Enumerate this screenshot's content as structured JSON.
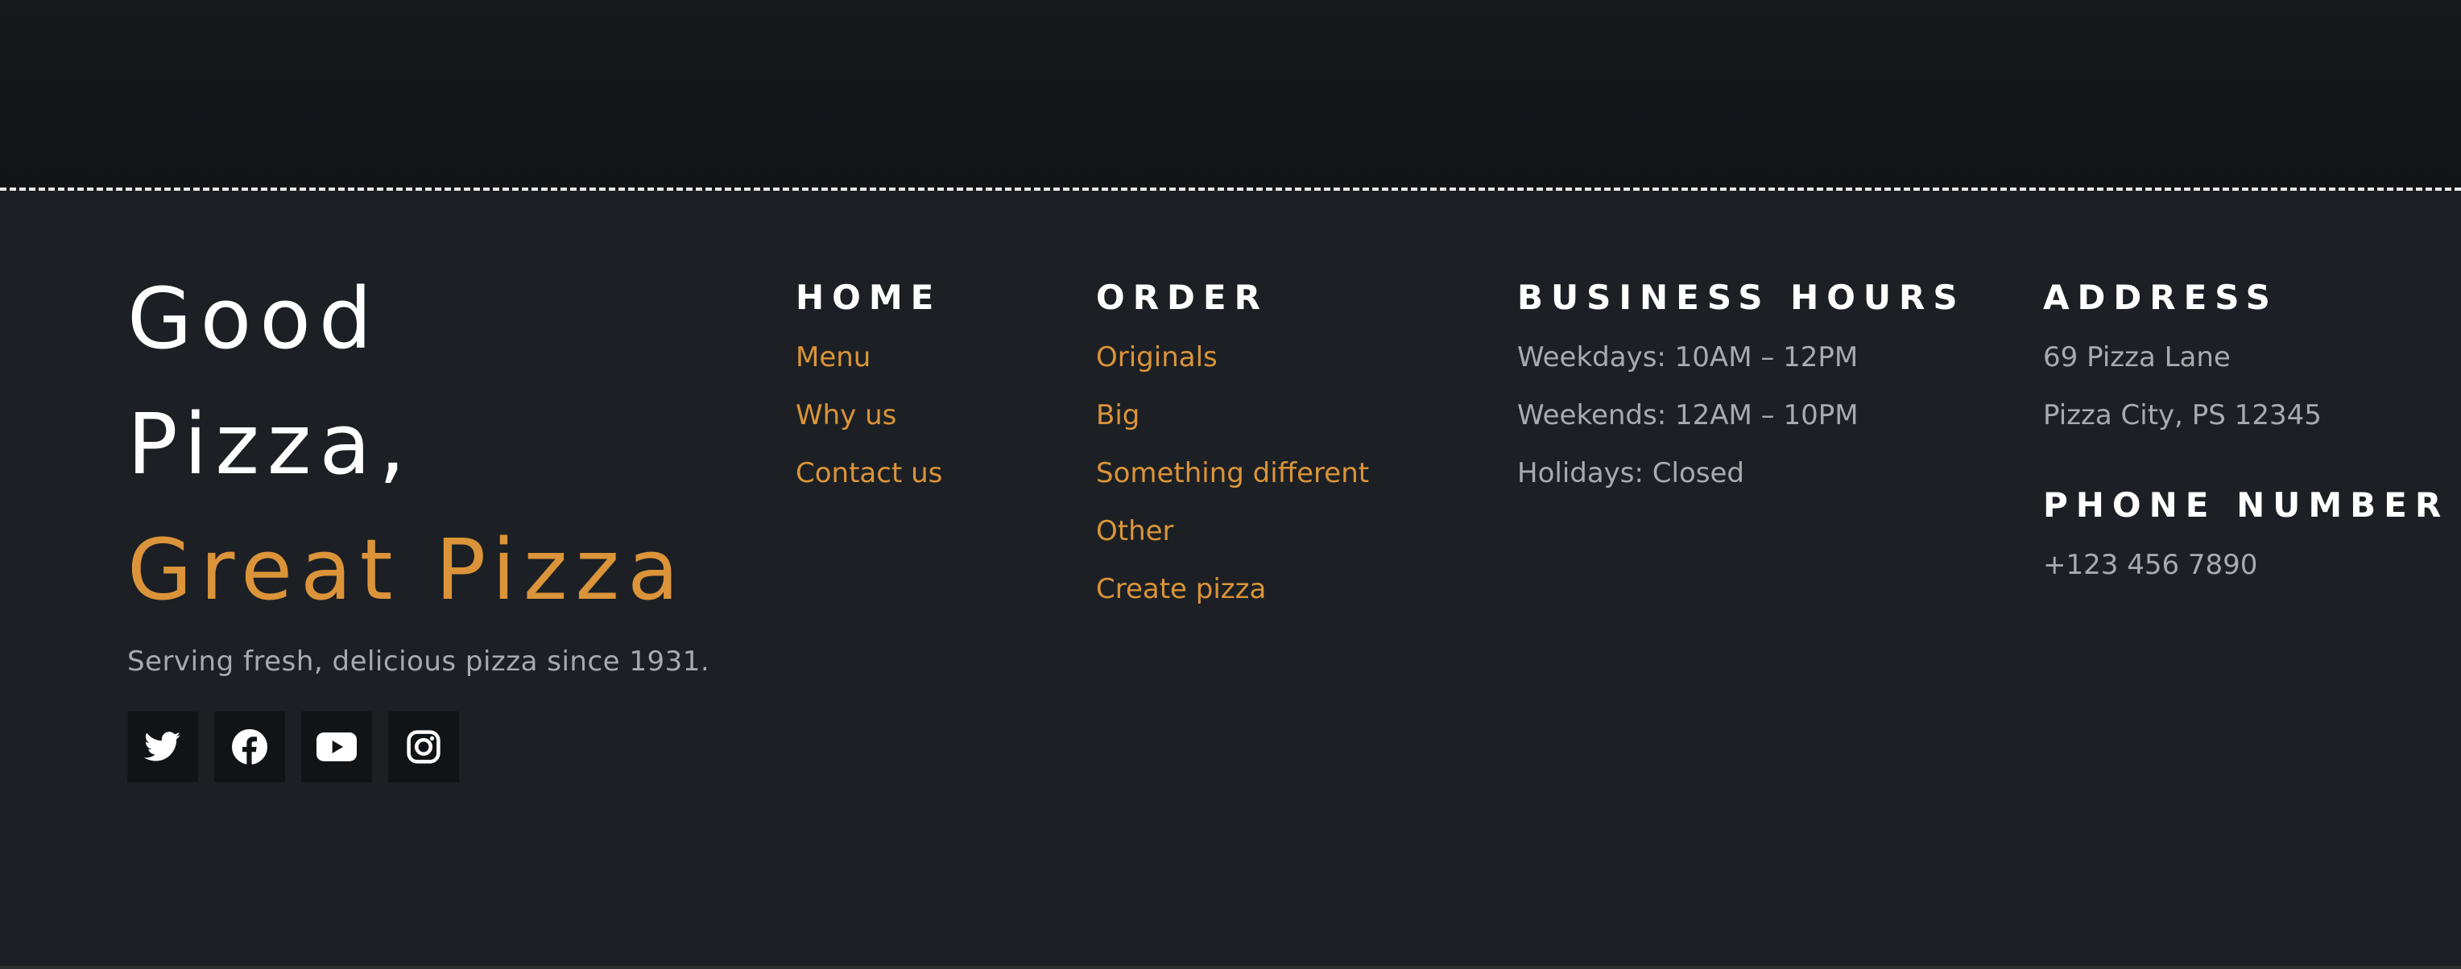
{
  "brand": {
    "title_line1": "Good",
    "title_line2": "Pizza,",
    "title_accent": "Great Pizza",
    "tagline": "Serving fresh, delicious pizza since 1931."
  },
  "socials": [
    {
      "name": "twitter-icon"
    },
    {
      "name": "facebook-icon"
    },
    {
      "name": "youtube-icon"
    },
    {
      "name": "instagram-icon"
    }
  ],
  "home": {
    "heading": "HOME",
    "links": [
      "Menu",
      "Why us",
      "Contact us"
    ]
  },
  "order": {
    "heading": "ORDER",
    "links": [
      "Originals",
      "Big",
      "Something different",
      "Other",
      "Create pizza"
    ]
  },
  "hours": {
    "heading": "BUSINESS HOURS",
    "lines": [
      "Weekdays: 10AM – 12PM",
      "Weekends: 12AM – 10PM",
      "Holidays: Closed"
    ]
  },
  "address": {
    "heading": "ADDRESS",
    "lines": [
      "69 Pizza Lane",
      "Pizza City, PS 12345"
    ]
  },
  "phone": {
    "heading": "PHONE NUMBER",
    "value": "+123 456 7890"
  },
  "colors": {
    "accent": "#db9439",
    "background": "#1c2024",
    "muted_text": "#a7abaf",
    "heading_text": "#ffffff"
  }
}
